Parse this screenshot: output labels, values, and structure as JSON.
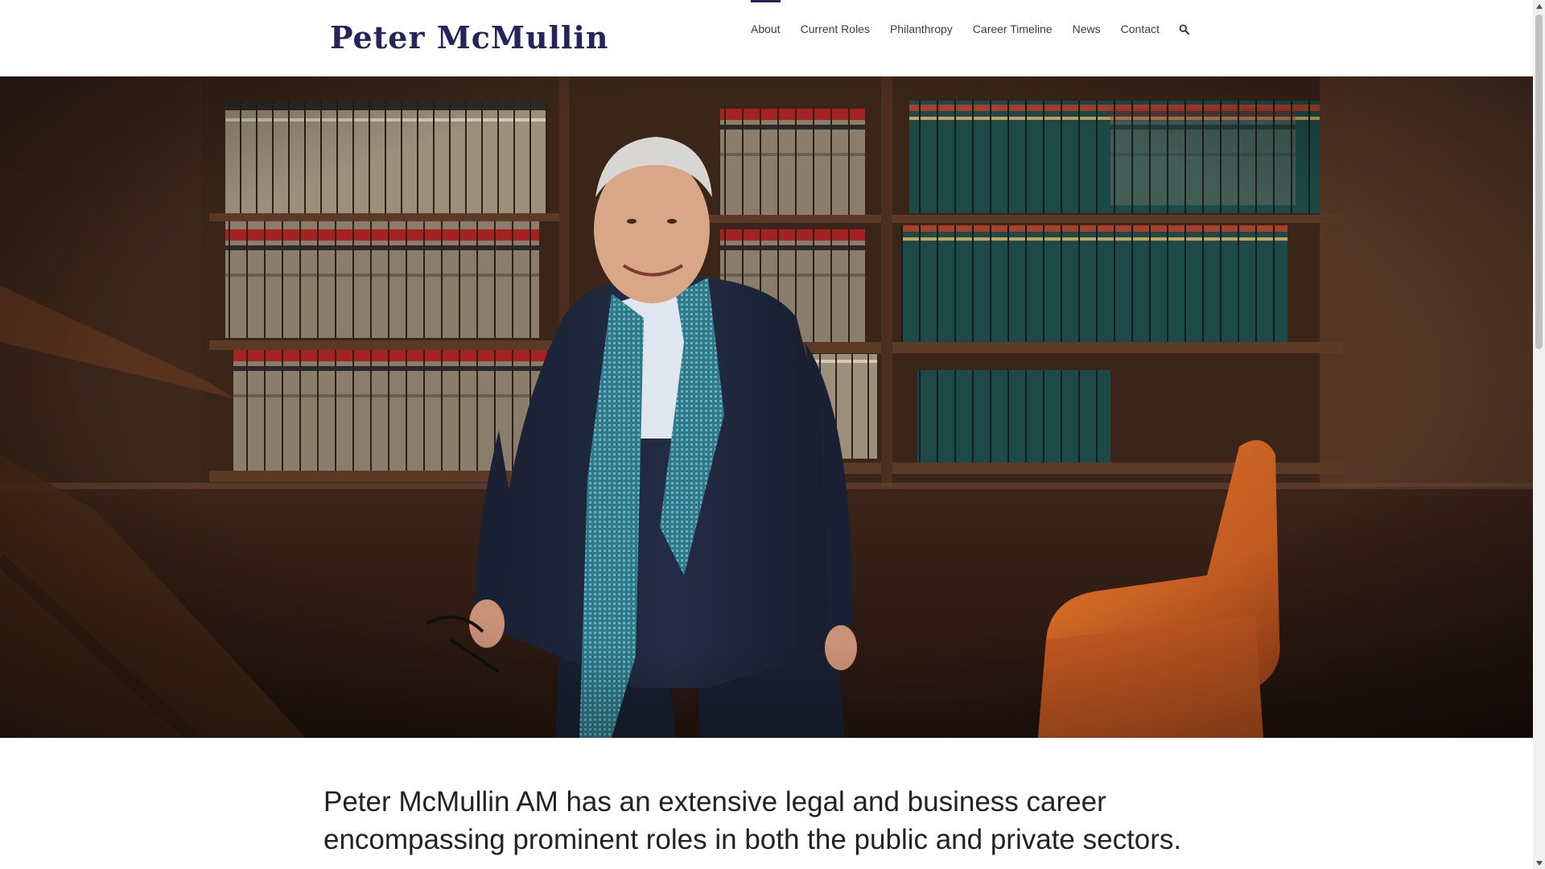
{
  "site": {
    "logo_text": "Peter McMullin"
  },
  "nav": {
    "items": [
      {
        "label": "About",
        "active": true
      },
      {
        "label": "Current Roles",
        "active": false
      },
      {
        "label": "Philanthropy",
        "active": false
      },
      {
        "label": "Career Timeline",
        "active": false
      },
      {
        "label": "News",
        "active": false
      },
      {
        "label": "Contact",
        "active": false
      }
    ],
    "search_icon": "search-icon"
  },
  "hero": {
    "image": "portrait-in-law-library"
  },
  "intro": {
    "text": "Peter McMullin AM has an extensive legal and business career encompassing prominent roles in both the public and private sectors."
  },
  "colors": {
    "brand": "#25255a",
    "nav_text": "#3b3b3b",
    "body_text": "#222222"
  }
}
